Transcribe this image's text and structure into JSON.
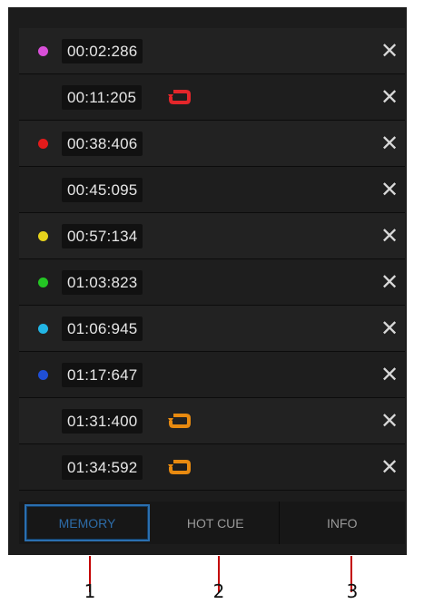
{
  "cues": [
    {
      "time": "00:02:286",
      "color": "#d94fd9",
      "loop": false
    },
    {
      "time": "00:11:205",
      "color": null,
      "loop": true,
      "loop_color": "#e3262a"
    },
    {
      "time": "00:38:406",
      "color": "#e31b1b",
      "loop": false
    },
    {
      "time": "00:45:095",
      "color": null,
      "loop": false
    },
    {
      "time": "00:57:134",
      "color": "#e6d21c",
      "loop": false
    },
    {
      "time": "01:03:823",
      "color": "#24c624",
      "loop": false
    },
    {
      "time": "01:06:945",
      "color": "#22b6e6",
      "loop": false
    },
    {
      "time": "01:17:647",
      "color": "#1f4fd6",
      "loop": false
    },
    {
      "time": "01:31:400",
      "color": null,
      "loop": true,
      "loop_color": "#e88a10"
    },
    {
      "time": "01:34:592",
      "color": null,
      "loop": true,
      "loop_color": "#e88a10"
    }
  ],
  "delete_icon": "close-icon",
  "tabs": {
    "memory": "MEMORY",
    "hot_cue": "HOT CUE",
    "info": "INFO"
  },
  "active_tab": "memory",
  "callouts": [
    "1",
    "2",
    "3"
  ]
}
